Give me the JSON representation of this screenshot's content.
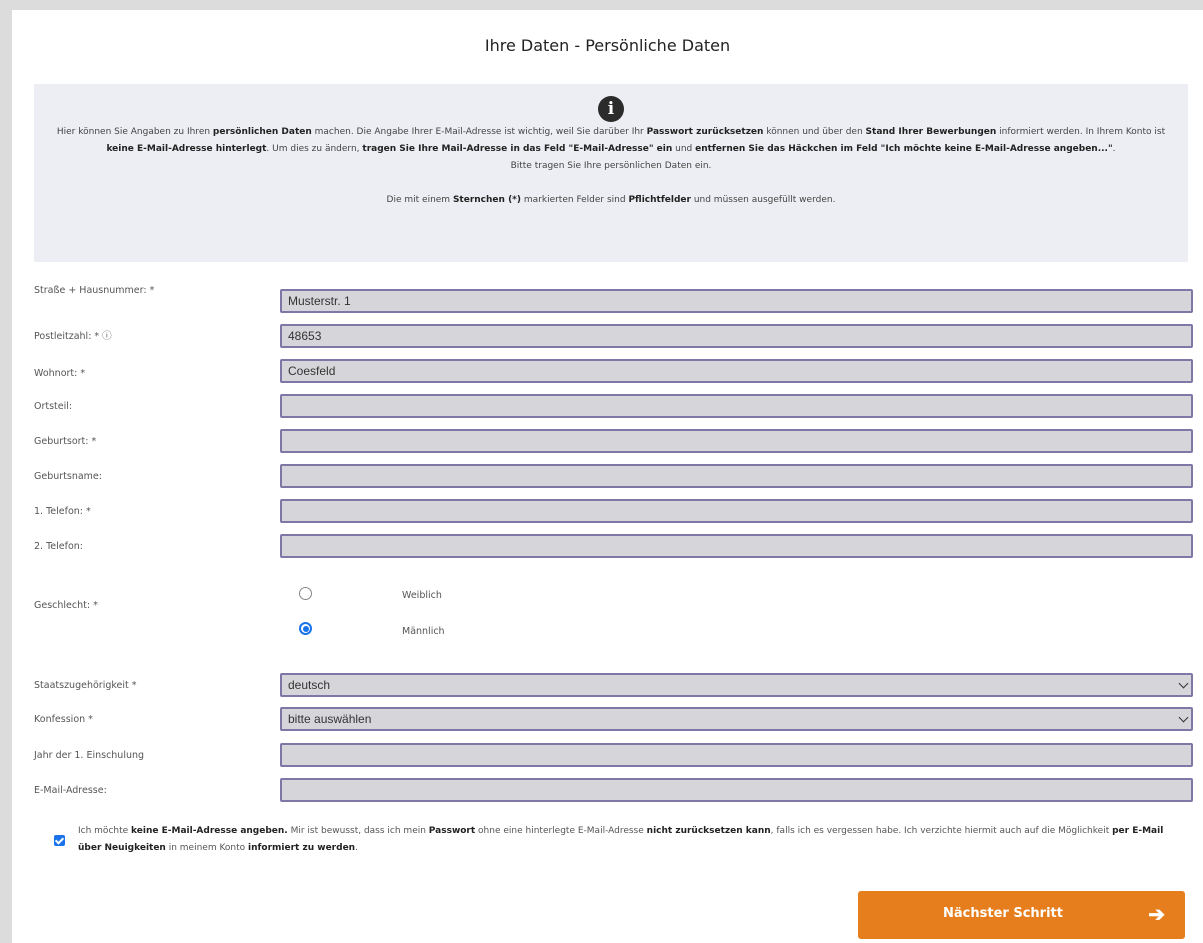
{
  "page_title": "Ihre Daten - Persönliche Daten",
  "info": {
    "icon": "info-icon",
    "p1_a": "Hier können Sie Angaben zu Ihren ",
    "p1_b": "persönlichen Daten",
    "p1_c": " machen. Die Angabe Ihrer E-Mail-Adresse ist wichtig, weil Sie darüber Ihr ",
    "p1_d": "Passwort zurücksetzen",
    "p1_e": " können und über den ",
    "p1_f": "Stand Ihrer Bewerbungen",
    "p1_g": " informiert werden. In Ihrem Konto ist ",
    "p1_h": "keine E-Mail-Adresse hinterlegt",
    "p1_i": ". Um dies zu ändern, ",
    "p1_j": "tragen Sie Ihre Mail-Adresse in das Feld \"E-Mail-Adresse\" ein",
    "p1_k": " und ",
    "p1_l": "entfernen Sie das Häckchen im Feld \"Ich möchte keine E-Mail-Adresse angeben...\"",
    "p1_m": ".",
    "p2": "Bitte tragen Sie Ihre persönlichen Daten ein.",
    "p3_a": "Die mit einem ",
    "p3_b": "Sternchen (*)",
    "p3_c": " markierten Felder sind ",
    "p3_d": "Pflichtfelder",
    "p3_e": " und müssen ausgefüllt werden."
  },
  "form": {
    "strasse": {
      "label": "Straße + Hausnummer: *",
      "value": "Musterstr. 1"
    },
    "plz": {
      "label": "Postleitzahl: * ⓘ",
      "value": "48653"
    },
    "wohnort": {
      "label": "Wohnort: *",
      "value": "Coesfeld"
    },
    "ortsteil": {
      "label": "Ortsteil:",
      "value": ""
    },
    "geburtsort": {
      "label": "Geburtsort: *",
      "value": ""
    },
    "geburtsname": {
      "label": "Geburtsname:",
      "value": ""
    },
    "telefon1": {
      "label": "1. Telefon: *",
      "value": ""
    },
    "telefon2": {
      "label": "2. Telefon:",
      "value": ""
    },
    "geschlecht": {
      "label": "Geschlecht: *",
      "options": [
        "Weiblich",
        "Männlich"
      ],
      "selected": "Männlich"
    },
    "staatsangehoerigkeit": {
      "label": "Staatszugehörigkeit *",
      "value": "deutsch"
    },
    "konfession": {
      "label": "Konfession *",
      "value": "bitte auswählen"
    },
    "einschulung": {
      "label": "Jahr der 1. Einschulung",
      "value": ""
    },
    "email": {
      "label": "E-Mail-Adresse:",
      "value": ""
    }
  },
  "consent": {
    "checked": true,
    "a": "Ich möchte ",
    "b": "keine E-Mail-Adresse angeben.",
    "c": " Mir ist bewusst, dass ich mein ",
    "d": "Passwort",
    "e": " ohne eine hinterlegte E-Mail-Adresse ",
    "f": "nicht zurücksetzen kann",
    "g": ", falls ich es vergessen habe. Ich verzichte hiermit auch auf die Möglichkeit ",
    "h": "per E-Mail über Neuigkeiten",
    "i": " in meinem Konto ",
    "j": "informiert zu werden",
    "k": "."
  },
  "next_button": {
    "label": "Nächster Schritt",
    "arrow": "➔"
  },
  "colors": {
    "accent": "#e67e1e",
    "field_bg": "#d6d6da",
    "field_border": "#7d78a6",
    "info_bg": "#eceef3",
    "check_blue": "#1a73e8"
  }
}
